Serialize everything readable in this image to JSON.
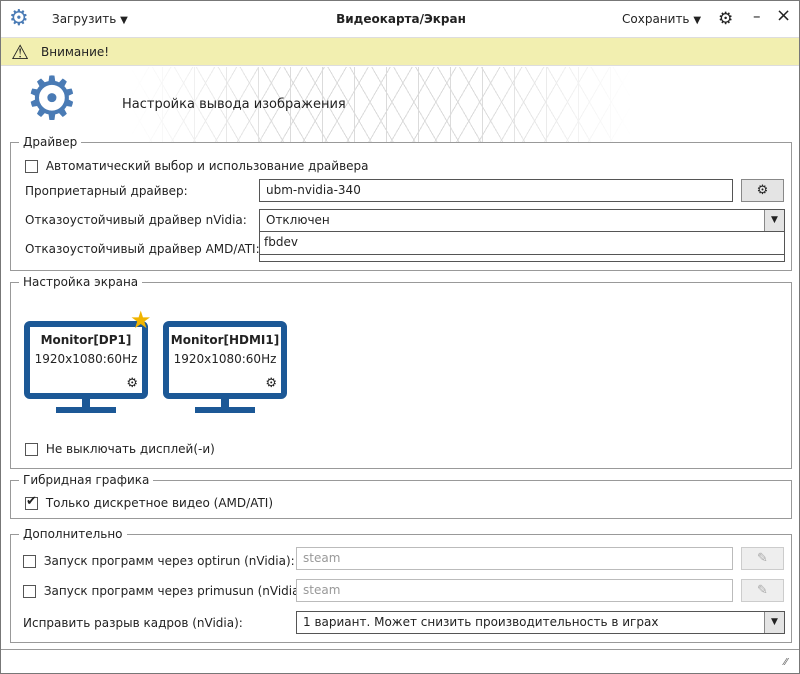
{
  "titlebar": {
    "load_label": "Загрузить",
    "title": "Видеокарта/Экран",
    "save_label": "Сохранить",
    "minimize": "–",
    "close": "×"
  },
  "warning": {
    "text": "Внимание!"
  },
  "header": {
    "title": "Настройка вывода изображения"
  },
  "driver": {
    "legend": "Драйвер",
    "auto_label": "Автоматический выбор и использование драйвера",
    "auto_checked": false,
    "proprietary_label": "Проприетарный драйвер:",
    "proprietary_value": "ubm-nvidia-340",
    "nvidia_failsafe_label": "Отказоустойчивый драйвер nVidia:",
    "nvidia_failsafe_value": "Отключен",
    "dropdown_options": [
      "fbdev"
    ],
    "amd_failsafe_label": "Отказоустойчивый драйвер AMD/ATI:"
  },
  "screen": {
    "legend": "Настройка экрана",
    "monitors": [
      {
        "name": "Monitor[DP1]",
        "mode": "1920x1080:60Hz",
        "primary": true
      },
      {
        "name": "Monitor[HDMI1]",
        "mode": "1920x1080:60Hz",
        "primary": false
      }
    ],
    "keep_on_label": "Не выключать дисплей(-и)",
    "keep_on_checked": false
  },
  "hybrid": {
    "legend": "Гибридная графика",
    "discrete_label": "Только дискретное видео (AMD/ATI)",
    "discrete_checked": true
  },
  "extra": {
    "legend": "Дополнительно",
    "optirun_label": "Запуск программ через optirun (nVidia):",
    "optirun_placeholder": "steam",
    "primusun_label": "Запуск программ через primusun (nVidia):",
    "primusun_placeholder": "steam",
    "tearing_label": "Исправить разрыв кадров (nVidia):",
    "tearing_value": "1 вариант. Может снизить производительность в играх"
  }
}
